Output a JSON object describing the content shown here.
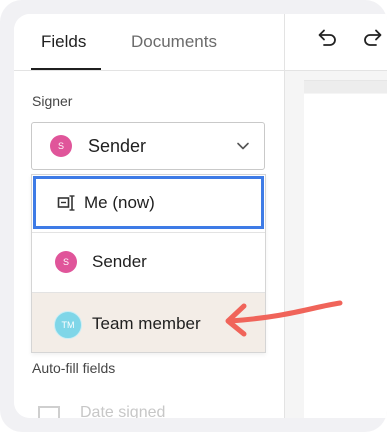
{
  "tabs": [
    {
      "label": "Fields",
      "active": true
    },
    {
      "label": "Documents",
      "active": false
    }
  ],
  "signer": {
    "label": "Signer",
    "selected": {
      "initials": "S",
      "name": "Sender",
      "color": "#e0559a"
    }
  },
  "dropdown": {
    "options": [
      {
        "label": "Me (now)",
        "icon": "me-now-icon",
        "focused": true
      },
      {
        "label": "Sender",
        "initials": "S",
        "color": "#e0559a"
      },
      {
        "label": "Team member",
        "initials": "TM",
        "color": "#7fd6e8",
        "highlighted": true
      }
    ]
  },
  "autofill": {
    "label": "Auto-fill fields",
    "items": [
      {
        "label": "Date signed",
        "icon": "calendar-icon"
      }
    ]
  },
  "toolbar": {
    "undo_icon": "undo-icon",
    "redo_icon": "redo-icon"
  },
  "colors": {
    "focus_border": "#3e7be6",
    "highlight_bg": "#f3ede7",
    "arrow": "#f0645a",
    "frame_bg": "#f1f1f4"
  }
}
